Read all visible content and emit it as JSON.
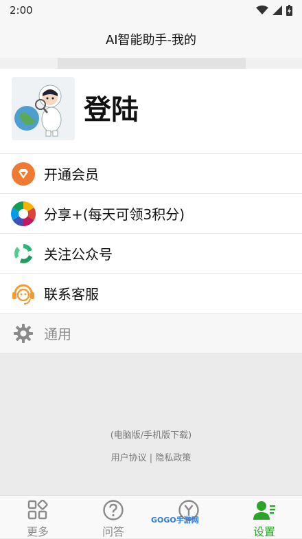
{
  "status_bar": {
    "time": "2:00"
  },
  "header": {
    "title": "AI智能助手-我的"
  },
  "profile": {
    "login_label": "登陆"
  },
  "menu": [
    {
      "label": "开通会员",
      "icon": "vip-gem-icon"
    },
    {
      "label": "分享+(每天可领3积分)",
      "icon": "share-aperture-icon"
    },
    {
      "label": "关注公众号",
      "icon": "wechat-official-icon"
    },
    {
      "label": "联系客服",
      "icon": "customer-service-icon"
    },
    {
      "label": "通用",
      "icon": "gear-icon"
    }
  ],
  "footer": {
    "download_link": "(电脑版/手机版下载)",
    "user_agreement": "用户协议",
    "separator": "|",
    "privacy_policy": "隐私政策"
  },
  "bottom_nav": [
    {
      "label": "更多",
      "icon": "grid-icon",
      "active": false
    },
    {
      "label": "问答",
      "icon": "question-icon",
      "active": false
    },
    {
      "label": "",
      "icon": "y-circle-icon",
      "active": false
    },
    {
      "label": "设置",
      "icon": "user-settings-icon",
      "active": true
    }
  ],
  "watermark": "GOGO手游网",
  "colors": {
    "accent_green": "#2aa52a",
    "vip_orange": "#f07a32"
  }
}
